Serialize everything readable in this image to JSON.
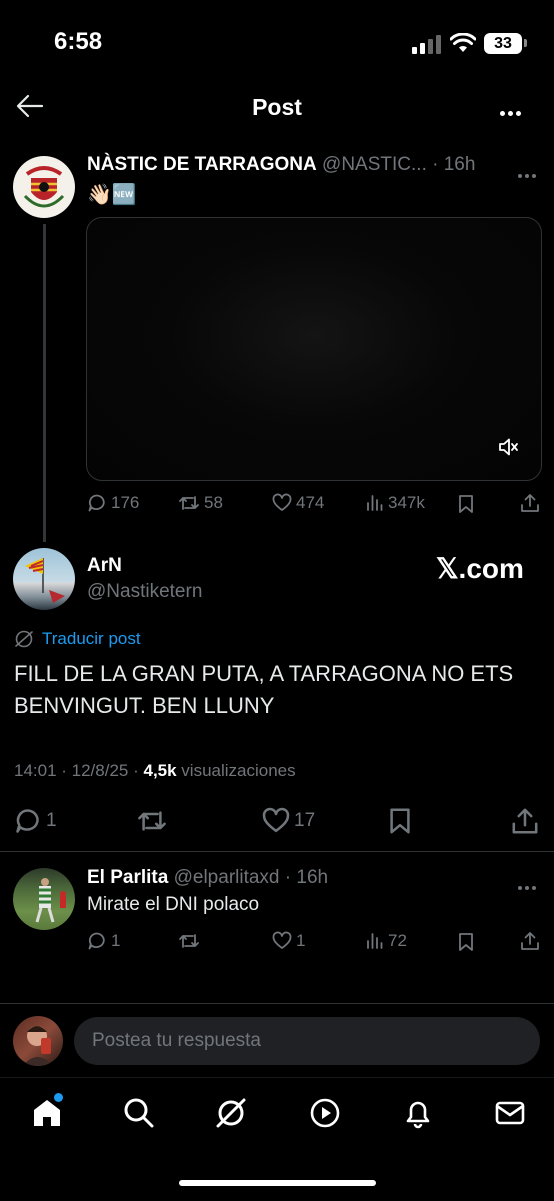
{
  "status_bar": {
    "time": "6:58",
    "battery": "33"
  },
  "header": {
    "title": "Post"
  },
  "parent_post": {
    "name": "NÀSTIC DE TARRAGONA",
    "handle": "@NASTIC...",
    "time": "· 16h",
    "emoji": "👋🏻🆕",
    "replies": "176",
    "reposts": "58",
    "likes": "474",
    "views": "347k"
  },
  "main_post": {
    "name": "ArN",
    "handle": "@Nastiketern",
    "watermark": "𝕏.com",
    "translate": "Traducir post",
    "text": "FILL DE LA GRAN PUTA, A TARRAGONA NO ETS BENVINGUT. BEN LLUNY",
    "meta_time": "14:01 · 12/8/25 · ",
    "views_count": "4,5k",
    "views_label": " visualizaciones",
    "replies": "1",
    "likes": "17"
  },
  "reply": {
    "name": "El Parlita",
    "handle": "@elparlitaxd",
    "time": "· 16h",
    "text": "Mirate el DNI polaco",
    "replies": "1",
    "likes": "1",
    "views": "72"
  },
  "composer": {
    "placeholder": "Postea tu respuesta"
  },
  "colors": {
    "accent": "#1d9bf0",
    "muted": "#71767b",
    "text": "#e7e9ea",
    "background": "#000000"
  }
}
